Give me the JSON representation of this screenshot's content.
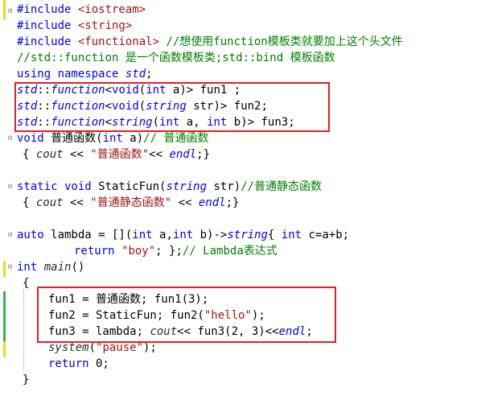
{
  "lines": [
    {
      "segments": [
        {
          "t": "#include ",
          "c": "pp"
        },
        {
          "t": "<iostream>",
          "c": "str"
        }
      ]
    },
    {
      "segments": [
        {
          "t": "#include ",
          "c": "pp"
        },
        {
          "t": "<string>",
          "c": "str"
        }
      ]
    },
    {
      "segments": [
        {
          "t": "#include ",
          "c": "pp"
        },
        {
          "t": "<functional>",
          "c": "str"
        },
        {
          "t": " //想使用function模板类就要加上这个头文件",
          "c": "cm"
        }
      ]
    },
    {
      "segments": [
        {
          "t": "//std::function 是一个函数模板类;std::bind 模板函数",
          "c": "cm"
        }
      ]
    },
    {
      "segments": [
        {
          "t": "using namespace ",
          "c": "kw"
        },
        {
          "t": "std",
          "c": "it"
        },
        {
          "t": ";",
          "c": "txt"
        }
      ]
    },
    {
      "segments": [
        {
          "t": "std",
          "c": "it"
        },
        {
          "t": "::",
          "c": "txt"
        },
        {
          "t": "function",
          "c": "it"
        },
        {
          "t": "<",
          "c": "txt"
        },
        {
          "t": "void",
          "c": "kw"
        },
        {
          "t": "(",
          "c": "txt"
        },
        {
          "t": "int",
          "c": "kw"
        },
        {
          "t": " a)> fun1 ;",
          "c": "txt"
        }
      ]
    },
    {
      "segments": [
        {
          "t": "std",
          "c": "it"
        },
        {
          "t": "::",
          "c": "txt"
        },
        {
          "t": "function",
          "c": "it"
        },
        {
          "t": "<",
          "c": "txt"
        },
        {
          "t": "void",
          "c": "kw"
        },
        {
          "t": "(",
          "c": "txt"
        },
        {
          "t": "string",
          "c": "it"
        },
        {
          "t": " str)> fun2;",
          "c": "txt"
        }
      ]
    },
    {
      "segments": [
        {
          "t": "std",
          "c": "it"
        },
        {
          "t": "::",
          "c": "txt"
        },
        {
          "t": "function",
          "c": "it"
        },
        {
          "t": "<",
          "c": "txt"
        },
        {
          "t": "string",
          "c": "it"
        },
        {
          "t": "(",
          "c": "txt"
        },
        {
          "t": "int",
          "c": "kw"
        },
        {
          "t": " a, ",
          "c": "txt"
        },
        {
          "t": "int",
          "c": "kw"
        },
        {
          "t": " b)> fun3;",
          "c": "txt"
        }
      ]
    },
    {
      "segments": [
        {
          "t": "void",
          "c": "kw"
        },
        {
          "t": " 普通函数(",
          "c": "txt"
        },
        {
          "t": "int",
          "c": "kw"
        },
        {
          "t": " a)",
          "c": "txt"
        },
        {
          "t": "// 普通函数",
          "c": "cm"
        }
      ]
    },
    {
      "segments": [
        {
          "t": "{ ",
          "c": "txt"
        },
        {
          "t": "cout",
          "c": "itn"
        },
        {
          "t": " << ",
          "c": "txt"
        },
        {
          "t": "\"普通函数\"",
          "c": "str"
        },
        {
          "t": "<< ",
          "c": "txt"
        },
        {
          "t": "endl",
          "c": "it"
        },
        {
          "t": ";}",
          "c": "txt"
        }
      ]
    },
    {
      "segments": []
    },
    {
      "segments": [
        {
          "t": "static void ",
          "c": "kw"
        },
        {
          "t": "StaticFun(",
          "c": "txt"
        },
        {
          "t": "string",
          "c": "it"
        },
        {
          "t": " str)",
          "c": "txt"
        },
        {
          "t": "//普通静态函数",
          "c": "cm"
        }
      ]
    },
    {
      "segments": [
        {
          "t": "{ ",
          "c": "txt"
        },
        {
          "t": "cout",
          "c": "itn"
        },
        {
          "t": " << ",
          "c": "txt"
        },
        {
          "t": "\"普通静态函数\"",
          "c": "str"
        },
        {
          "t": " << ",
          "c": "txt"
        },
        {
          "t": "endl",
          "c": "it"
        },
        {
          "t": ";}",
          "c": "txt"
        }
      ]
    },
    {
      "segments": []
    },
    {
      "segments": [
        {
          "t": "auto",
          "c": "kw"
        },
        {
          "t": " lambda = [](",
          "c": "txt"
        },
        {
          "t": "int",
          "c": "kw"
        },
        {
          "t": " a,",
          "c": "txt"
        },
        {
          "t": "int",
          "c": "kw"
        },
        {
          "t": " b)->",
          "c": "txt"
        },
        {
          "t": "string",
          "c": "it"
        },
        {
          "t": "{ ",
          "c": "txt"
        },
        {
          "t": "int",
          "c": "kw"
        },
        {
          "t": " c=a+b;",
          "c": "txt"
        }
      ]
    },
    {
      "segments": [
        {
          "t": "return",
          "c": "kw"
        },
        {
          "t": " ",
          "c": "txt"
        },
        {
          "t": "\"boy\"",
          "c": "str"
        },
        {
          "t": "; };",
          "c": "txt"
        },
        {
          "t": "// Lambda表达式",
          "c": "cm"
        }
      ]
    },
    {
      "segments": [
        {
          "t": "int",
          "c": "kw"
        },
        {
          "t": " ",
          "c": "txt"
        },
        {
          "t": "main",
          "c": "itn"
        },
        {
          "t": "()",
          "c": "txt"
        }
      ]
    },
    {
      "segments": [
        {
          "t": "{",
          "c": "txt"
        }
      ]
    },
    {
      "segments": [
        {
          "t": "fun1 = 普通函数; fun1(3);",
          "c": "txt"
        }
      ]
    },
    {
      "segments": [
        {
          "t": "fun2 = StaticFun; fun2(",
          "c": "txt"
        },
        {
          "t": "\"hello\"",
          "c": "str"
        },
        {
          "t": ");",
          "c": "txt"
        }
      ]
    },
    {
      "segments": [
        {
          "t": "fun3 = lambda; ",
          "c": "txt"
        },
        {
          "t": "cout",
          "c": "itn"
        },
        {
          "t": "<< fun3(2, 3)<<",
          "c": "txt"
        },
        {
          "t": "endl",
          "c": "it"
        },
        {
          "t": ";",
          "c": "txt"
        }
      ]
    },
    {
      "segments": [
        {
          "t": "system",
          "c": "itn"
        },
        {
          "t": "(",
          "c": "txt"
        },
        {
          "t": "\"pause\"",
          "c": "str"
        },
        {
          "t": ");",
          "c": "txt"
        }
      ]
    },
    {
      "segments": [
        {
          "t": "return",
          "c": "kw"
        },
        {
          "t": " 0;",
          "c": "txt"
        }
      ]
    },
    {
      "segments": [
        {
          "t": "}",
          "c": "txt"
        }
      ]
    }
  ],
  "colors": {
    "keyword": "#0000ff",
    "string": "#a31515",
    "comment": "#008000",
    "highlight_box": "#e02020",
    "changed_bar_yellow": "#f5d516",
    "changed_bar_green": "#3fb050"
  }
}
